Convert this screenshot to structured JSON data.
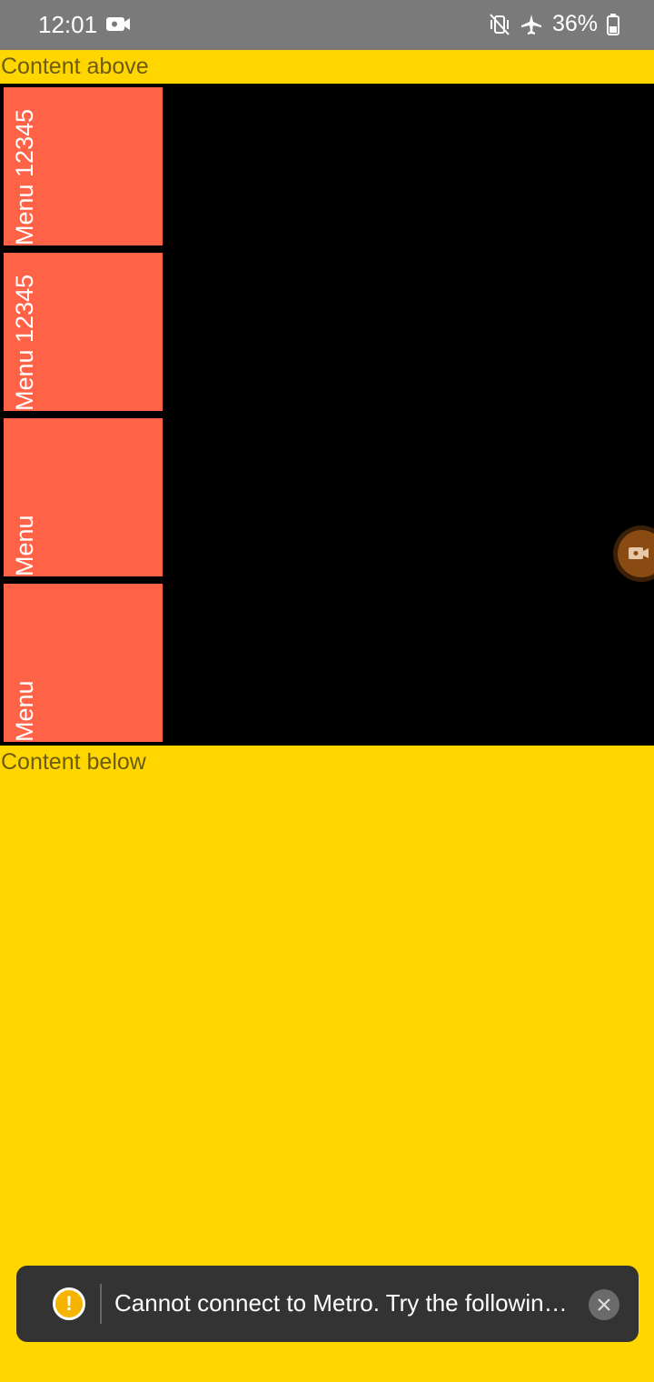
{
  "status_bar": {
    "time": "12:01",
    "battery": "36%",
    "icons": [
      "video-camera-icon",
      "mute-vibrate-icon",
      "airplane-icon",
      "battery-icon"
    ]
  },
  "content": {
    "above": "Content above",
    "below": "Content below"
  },
  "menu": {
    "items": [
      {
        "label": "Menu 12345"
      },
      {
        "label": "Menu 12345"
      },
      {
        "label": "Menu"
      },
      {
        "label": "Menu"
      }
    ]
  },
  "toast": {
    "message": "Cannot connect to Metro.  Try the followin…",
    "icon": "warning-icon"
  },
  "colors": {
    "background": "#FFD600",
    "menu_item": "#FF6347",
    "panel": "#000000",
    "status_bar": "#7A7A7A",
    "toast": "#333333",
    "warning": "#F4B400"
  }
}
